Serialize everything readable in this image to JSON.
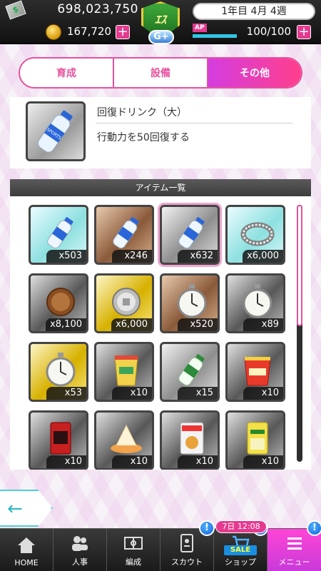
{
  "header": {
    "money": "698,023,750",
    "coins": "167,720",
    "plus_symbol": "+",
    "date": "1年目 4月 4週",
    "ap_label": "AP",
    "ap_value": "100/100",
    "ap_level": 1.0,
    "rank": "G+",
    "team_emblem_text": "ｴｽ"
  },
  "tabs": [
    {
      "label": "育成",
      "active": false
    },
    {
      "label": "設備",
      "active": false
    },
    {
      "label": "その他",
      "active": true
    }
  ],
  "detail": {
    "name": "回復ドリンク（大）",
    "description": "行動力を50回復する",
    "icon": "water-bottle-icon"
  },
  "list": {
    "header": "アイテム一覧",
    "items": [
      {
        "icon": "water-bottle-icon",
        "count": "x503",
        "frame": "cyan",
        "selected": false
      },
      {
        "icon": "water-bottle-icon",
        "count": "x246",
        "frame": "bronze",
        "selected": false
      },
      {
        "icon": "water-bottle-icon",
        "count": "x632",
        "frame": "silver",
        "selected": true
      },
      {
        "icon": "silver-ring-icon",
        "count": "x6,000",
        "frame": "cyan",
        "selected": false
      },
      {
        "icon": "bronze-coin-icon",
        "count": "x8,100",
        "frame": "dark",
        "selected": false
      },
      {
        "icon": "silver-coin-icon",
        "count": "x6,000",
        "frame": "gold",
        "selected": false
      },
      {
        "icon": "stopwatch-icon",
        "count": "x520",
        "frame": "bronze",
        "selected": false
      },
      {
        "icon": "stopwatch-icon",
        "count": "x89",
        "frame": "dark",
        "selected": false
      },
      {
        "icon": "stopwatch-icon",
        "count": "x53",
        "frame": "gold",
        "selected": false
      },
      {
        "icon": "snack-cup-icon",
        "count": "x10",
        "frame": "dark",
        "selected": false
      },
      {
        "icon": "green-bottle-icon",
        "count": "x15",
        "frame": "silver",
        "selected": false
      },
      {
        "icon": "noodle-cup-icon",
        "count": "x10",
        "frame": "dark",
        "selected": false
      },
      {
        "icon": "candy-bag-icon",
        "count": "x10",
        "frame": "dark",
        "selected": false
      },
      {
        "icon": "dessert-plate-icon",
        "count": "x10",
        "frame": "dark",
        "selected": false
      },
      {
        "icon": "snack-bag-icon",
        "count": "x10",
        "frame": "dark",
        "selected": false
      },
      {
        "icon": "yellow-candy-bag-icon",
        "count": "x10",
        "frame": "dark",
        "selected": false
      }
    ]
  },
  "nav": {
    "items": [
      {
        "label": "HOME",
        "icon": "home-icon",
        "active": false,
        "badge": ""
      },
      {
        "label": "人事",
        "icon": "people-icon",
        "active": false,
        "badge": ""
      },
      {
        "label": "編成",
        "icon": "field-icon",
        "active": false,
        "badge": ""
      },
      {
        "label": "スカウト",
        "icon": "scout-card-icon",
        "active": false,
        "badge": "!"
      },
      {
        "label": "ショップ",
        "icon": "shop-cart-icon",
        "active": false,
        "badge": "!"
      },
      {
        "label": "メニュー",
        "icon": "menu-icon",
        "active": true,
        "badge": "!"
      }
    ],
    "sale_time": "7日 12:08",
    "sale_tag": "SALE"
  },
  "back_icon": "back-arrow-icon",
  "colors": {
    "accent_pink": "#e6529e",
    "tab_active_start": "#d43de0",
    "tab_active_end": "#ff3e8c",
    "ap_bar": "#30c6e8",
    "badge_blue": "#1563d9"
  }
}
